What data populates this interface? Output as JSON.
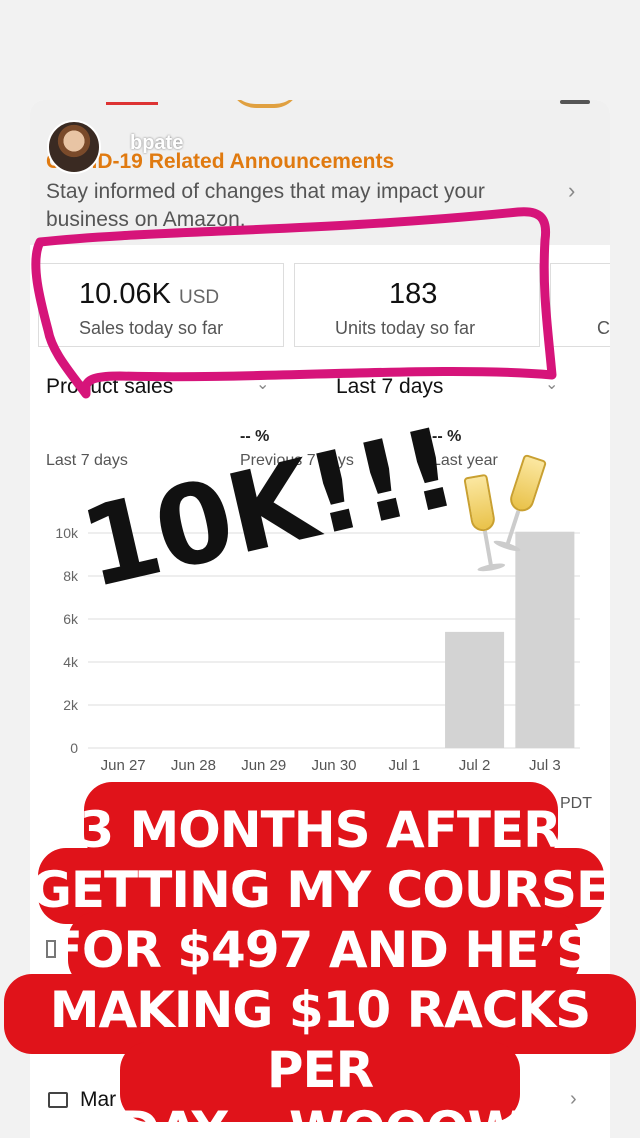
{
  "story": {
    "username": "bpate"
  },
  "announcement": {
    "title": "COVID-19 Related Announcements",
    "body": "Stay informed of changes that may impact your business on Amazon.",
    "chevron": "›"
  },
  "metrics": [
    {
      "value": "10.06K",
      "unit": "USD",
      "label": "Sales today so far"
    },
    {
      "value": "183",
      "unit": "",
      "label": "Units today so far"
    },
    {
      "value": "",
      "unit": "",
      "label": "C"
    }
  ],
  "dropdowns": {
    "metric": "Product sales",
    "range": "Last 7 days"
  },
  "stats": [
    {
      "value": "",
      "label": "Last 7 days"
    },
    {
      "value": "-- %",
      "label": "Previous 7 days"
    },
    {
      "value": "-- %",
      "label": "Last year"
    }
  ],
  "chart_data": {
    "type": "bar",
    "categories": [
      "Jun 27",
      "Jun 28",
      "Jun 29",
      "Jun 30",
      "Jul 1",
      "Jul 2",
      "Jul 3"
    ],
    "values": [
      0,
      0,
      0,
      0,
      0,
      5400,
      10060
    ],
    "yticks": [
      "0",
      "2k",
      "4k",
      "6k",
      "8k",
      "10k"
    ],
    "ylim": [
      0,
      10000
    ],
    "grid": true,
    "bar_color": "#d3d3d3"
  },
  "timezone_label": "PDT",
  "overlay": {
    "big_text": "10K!!!",
    "caption_lines": [
      "3 MONTHS AFTER",
      "GETTING MY COURSE",
      "FOR $497 AND HE’S",
      "MAKING $10 RACKS PER",
      "DAY... WOOOW"
    ],
    "caption_color": "#e0131a",
    "highlight_color": "#d6147a",
    "emoji": "champagne-glasses-icon"
  },
  "footer": {
    "label": "Mar",
    "chevron": "›"
  }
}
